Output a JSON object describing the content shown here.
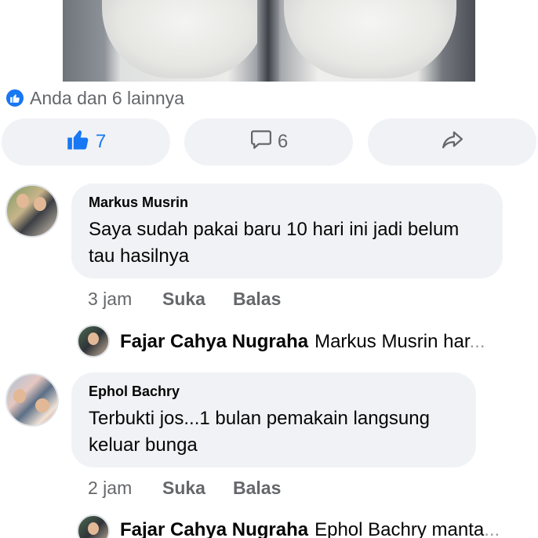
{
  "post": {
    "reactions_text": "Anda dan 6 lainnya"
  },
  "actions": {
    "like_count": "7",
    "comment_count": "6"
  },
  "comments": [
    {
      "author": "Markus Musrin",
      "text_line1": "Saya sudah pakai baru 10 hari ini jadi belum",
      "text_line2": "tau hasilnya",
      "time": "3 jam",
      "like_label": "Suka",
      "reply_label": "Balas",
      "reply": {
        "author": "Fajar Cahya Nugraha",
        "preview": "Markus Musrin har",
        "ellipsis": "..."
      }
    },
    {
      "author": "Ephol Bachry",
      "text_line1": "Terbukti jos...1 bulan pemakain langsung",
      "text_line2": "keluar bunga",
      "time": "2 jam",
      "like_label": "Suka",
      "reply_label": "Balas",
      "reply": {
        "author": "Fajar Cahya Nugraha",
        "preview": "Ephol Bachry manta",
        "ellipsis": "..."
      }
    }
  ],
  "icons": {
    "like": "thumbs-up-icon",
    "comment": "comment-bubble-icon",
    "share": "share-arrow-icon"
  },
  "colors": {
    "accent": "#1877f2",
    "bubble": "#f0f2f5",
    "secondary_text": "#65676b"
  }
}
